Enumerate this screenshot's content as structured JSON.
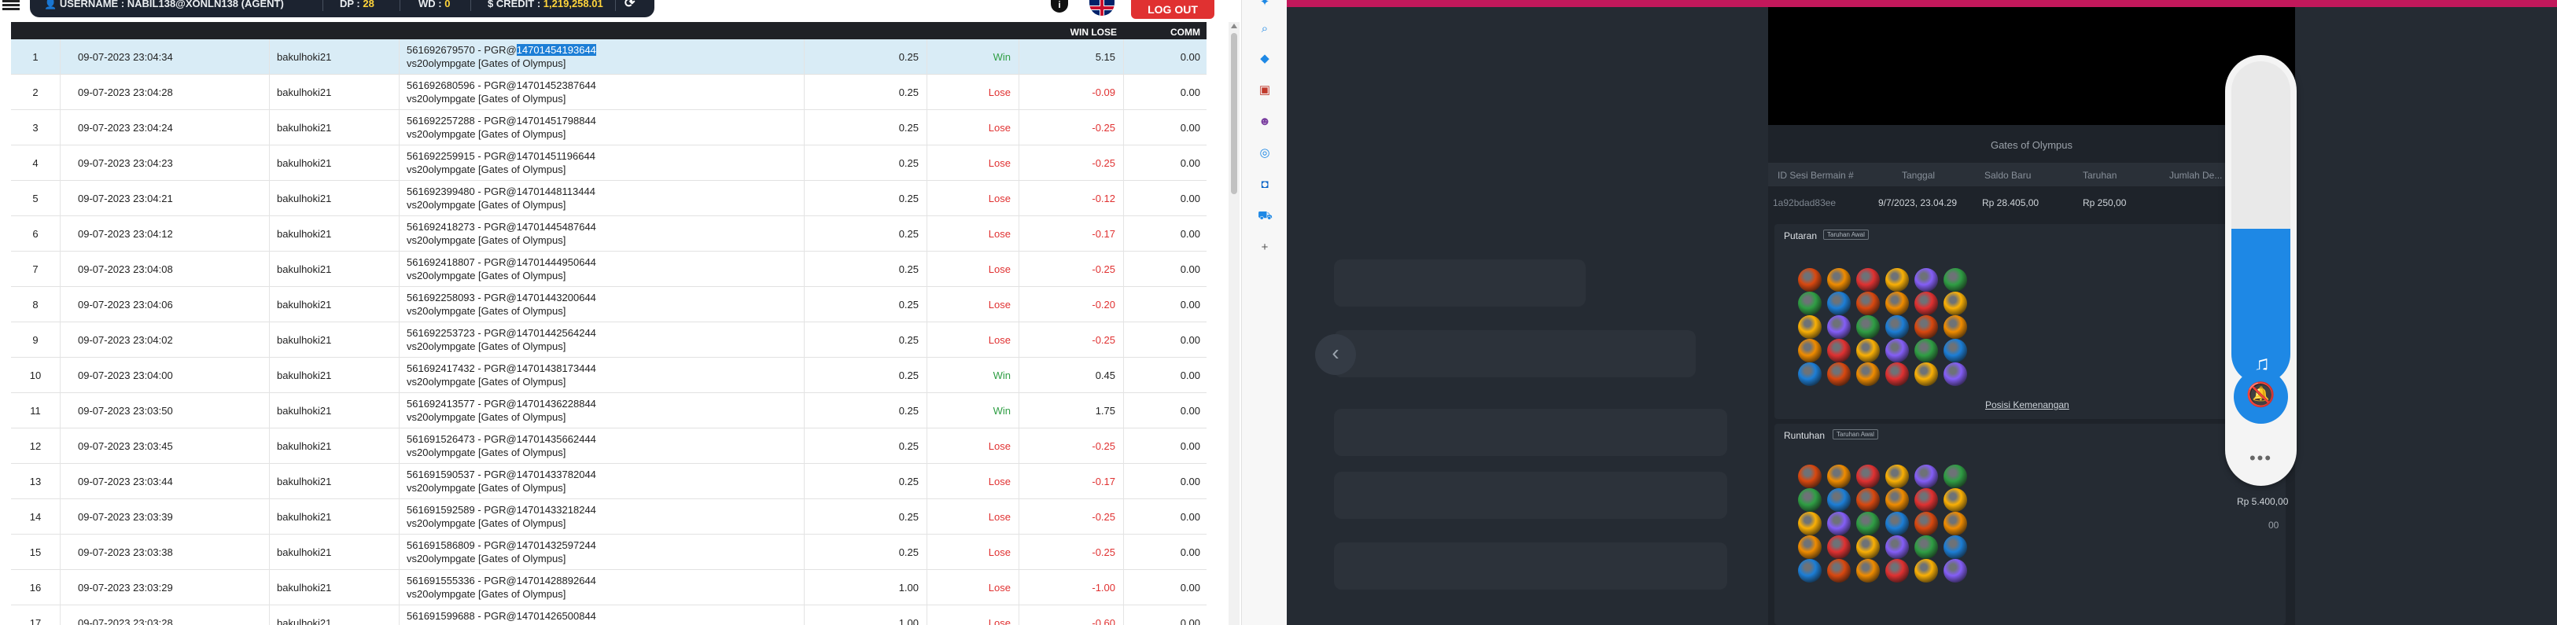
{
  "topbar": {
    "username_label": "USERNAME : ",
    "username_value": "NABIL138@XONLN138 (AGENT)",
    "dp_label": "DP : ",
    "dp_value": "28",
    "wd_label": "WD : ",
    "wd_value": "0",
    "credit_label": "$ CREDIT : ",
    "credit_value": "1,219,258.01",
    "info_glyph": "i",
    "logout_label": "LOG OUT"
  },
  "grid": {
    "headers": {
      "winlose": "WIN LOSE",
      "comm": "COMM"
    },
    "highlight": "14701454193644",
    "rows": [
      {
        "no": "1",
        "date": "09-07-2023 23:04:34",
        "user": "bakulhoki21",
        "desc1": "561692679570 - PGR@",
        "desc1b": "14701454193644",
        "desc2": "vs20olympgate [Gates of Olympus]",
        "bet": "0.25",
        "result": "Win",
        "winlose": "5.15",
        "comm": "0.00"
      },
      {
        "no": "2",
        "date": "09-07-2023 23:04:28",
        "user": "bakulhoki21",
        "desc1": "561692680596 - PGR@14701452387644",
        "desc1b": "",
        "desc2": "vs20olympgate [Gates of Olympus]",
        "bet": "0.25",
        "result": "Lose",
        "winlose": "-0.09",
        "comm": "0.00"
      },
      {
        "no": "3",
        "date": "09-07-2023 23:04:24",
        "user": "bakulhoki21",
        "desc1": "561692257288 - PGR@14701451798844",
        "desc1b": "",
        "desc2": "vs20olympgate [Gates of Olympus]",
        "bet": "0.25",
        "result": "Lose",
        "winlose": "-0.25",
        "comm": "0.00"
      },
      {
        "no": "4",
        "date": "09-07-2023 23:04:23",
        "user": "bakulhoki21",
        "desc1": "561692259915 - PGR@14701451196644",
        "desc1b": "",
        "desc2": "vs20olympgate [Gates of Olympus]",
        "bet": "0.25",
        "result": "Lose",
        "winlose": "-0.25",
        "comm": "0.00"
      },
      {
        "no": "5",
        "date": "09-07-2023 23:04:21",
        "user": "bakulhoki21",
        "desc1": "561692399480 - PGR@14701448113444",
        "desc1b": "",
        "desc2": "vs20olympgate [Gates of Olympus]",
        "bet": "0.25",
        "result": "Lose",
        "winlose": "-0.12",
        "comm": "0.00"
      },
      {
        "no": "6",
        "date": "09-07-2023 23:04:12",
        "user": "bakulhoki21",
        "desc1": "561692418273 - PGR@14701445487644",
        "desc1b": "",
        "desc2": "vs20olympgate [Gates of Olympus]",
        "bet": "0.25",
        "result": "Lose",
        "winlose": "-0.17",
        "comm": "0.00"
      },
      {
        "no": "7",
        "date": "09-07-2023 23:04:08",
        "user": "bakulhoki21",
        "desc1": "561692418807 - PGR@14701444950644",
        "desc1b": "",
        "desc2": "vs20olympgate [Gates of Olympus]",
        "bet": "0.25",
        "result": "Lose",
        "winlose": "-0.25",
        "comm": "0.00"
      },
      {
        "no": "8",
        "date": "09-07-2023 23:04:06",
        "user": "bakulhoki21",
        "desc1": "561692258093 - PGR@14701443200644",
        "desc1b": "",
        "desc2": "vs20olympgate [Gates of Olympus]",
        "bet": "0.25",
        "result": "Lose",
        "winlose": "-0.20",
        "comm": "0.00"
      },
      {
        "no": "9",
        "date": "09-07-2023 23:04:02",
        "user": "bakulhoki21",
        "desc1": "561692253723 - PGR@14701442564244",
        "desc1b": "",
        "desc2": "vs20olympgate [Gates of Olympus]",
        "bet": "0.25",
        "result": "Lose",
        "winlose": "-0.25",
        "comm": "0.00"
      },
      {
        "no": "10",
        "date": "09-07-2023 23:04:00",
        "user": "bakulhoki21",
        "desc1": "561692417432 - PGR@14701438173444",
        "desc1b": "",
        "desc2": "vs20olympgate [Gates of Olympus]",
        "bet": "0.25",
        "result": "Win",
        "winlose": "0.45",
        "comm": "0.00"
      },
      {
        "no": "11",
        "date": "09-07-2023 23:03:50",
        "user": "bakulhoki21",
        "desc1": "561692413577 - PGR@14701436228844",
        "desc1b": "",
        "desc2": "vs20olympgate [Gates of Olympus]",
        "bet": "0.25",
        "result": "Win",
        "winlose": "1.75",
        "comm": "0.00"
      },
      {
        "no": "12",
        "date": "09-07-2023 23:03:45",
        "user": "bakulhoki21",
        "desc1": "561691526473 - PGR@14701435662444",
        "desc1b": "",
        "desc2": "vs20olympgate [Gates of Olympus]",
        "bet": "0.25",
        "result": "Lose",
        "winlose": "-0.25",
        "comm": "0.00"
      },
      {
        "no": "13",
        "date": "09-07-2023 23:03:44",
        "user": "bakulhoki21",
        "desc1": "561691590537 - PGR@14701433782044",
        "desc1b": "",
        "desc2": "vs20olympgate [Gates of Olympus]",
        "bet": "0.25",
        "result": "Lose",
        "winlose": "-0.17",
        "comm": "0.00"
      },
      {
        "no": "14",
        "date": "09-07-2023 23:03:39",
        "user": "bakulhoki21",
        "desc1": "561691592589 - PGR@14701433218244",
        "desc1b": "",
        "desc2": "vs20olympgate [Gates of Olympus]",
        "bet": "0.25",
        "result": "Lose",
        "winlose": "-0.25",
        "comm": "0.00"
      },
      {
        "no": "15",
        "date": "09-07-2023 23:03:38",
        "user": "bakulhoki21",
        "desc1": "561691586809 - PGR@14701432597244",
        "desc1b": "",
        "desc2": "vs20olympgate [Gates of Olympus]",
        "bet": "0.25",
        "result": "Lose",
        "winlose": "-0.25",
        "comm": "0.00"
      },
      {
        "no": "16",
        "date": "09-07-2023 23:03:29",
        "user": "bakulhoki21",
        "desc1": "561691555336 - PGR@14701428892644",
        "desc1b": "",
        "desc2": "vs20olympgate [Gates of Olympus]",
        "bet": "1.00",
        "result": "Lose",
        "winlose": "-1.00",
        "comm": "0.00"
      },
      {
        "no": "17",
        "date": "09-07-2023 23:03:28",
        "user": "bakulhoki21",
        "desc1": "561691599688 - PGR@14701426500844",
        "desc1b": "",
        "desc2": "vs20olympgate [Gates of Olympus]",
        "bet": "1.00",
        "result": "Lose",
        "winlose": "-0.60",
        "comm": "0.00"
      }
    ]
  },
  "sidebar_icons": [
    "pin-icon",
    "search-icon",
    "tag-icon",
    "toolbox-icon",
    "people-icon",
    "globe-icon",
    "outlook-icon",
    "cart-icon",
    "add-icon"
  ],
  "modal": {
    "title": "Gates of Olympus",
    "headers": {
      "session": "ID Sesi Bermain #",
      "date": "Tanggal",
      "balance": "Saldo Baru",
      "bet": "Taruhan",
      "total": "Jumlah De..."
    },
    "values": {
      "session": "1a92bdad83ee",
      "date": "9/7/2023, 23.04.29",
      "balance": "Rp 28.405,00",
      "bet": "Rp 250,00",
      "total": "00"
    },
    "spin_section": "Putaran",
    "spin_tag": "Taruhan Awal",
    "win_link": "Posisi Kemenangan",
    "tumble_section": "Runtuhan",
    "tumble_tag": "Taruhan Awal",
    "side_amount": "Rp 5.400,00",
    "side_val_1": "00",
    "side_val_2": "00"
  },
  "volume": {
    "level_percent": 48,
    "more": "•••"
  },
  "colors": {
    "win": "#2f9e44",
    "lose": "#e03131",
    "accent": "#1e88e5",
    "pink": "#c2185b"
  }
}
